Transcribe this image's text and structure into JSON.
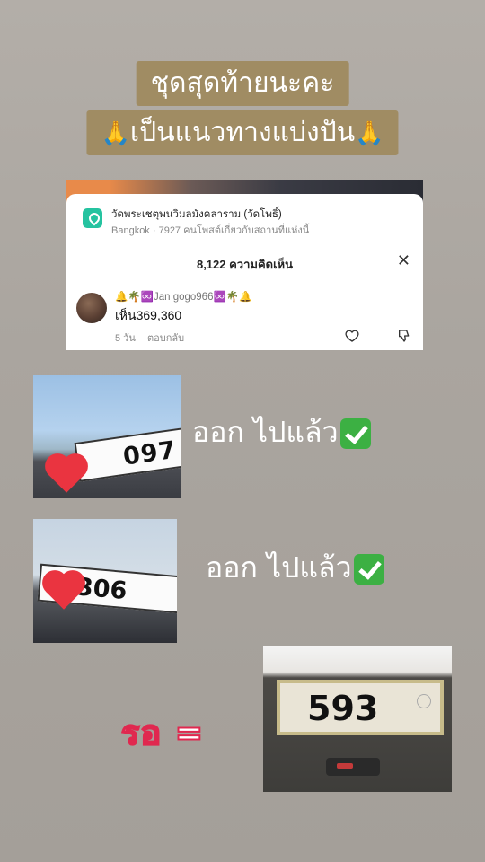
{
  "title": {
    "line1": "ชุดสุดท้ายนะคะ",
    "line2": "เป็นแนวทางแบ่งปัน",
    "line2_icon": "🙏"
  },
  "comment_card": {
    "place_name": "วัดพระเชตุพนวิมลมังคลาราม (วัดโพธิ์)",
    "place_sub": "Bangkok · 7927 คนโพสต์เกี่ยวกับสถานที่แห่งนี้",
    "comment_count": "8,122 ความคิดเห็น",
    "close_icon": "close-icon",
    "comment": {
      "username": "🔔🌴♾️Jan gogo966♾️🌴🔔",
      "text": "เห็น369,360",
      "time": "5 วัน",
      "reply": "ตอบกลับ"
    }
  },
  "items": [
    {
      "plate": "097",
      "status": "ออก ไปแล้ว"
    },
    {
      "plate": "306",
      "status": "ออก ไปแล้ว"
    },
    {
      "plate": "593",
      "label": "รอ ="
    }
  ],
  "colors": {
    "title_bg": "#a08c63",
    "heart": "#ea3440",
    "check": "#3cb043",
    "wait_outline": "#e0284f"
  }
}
